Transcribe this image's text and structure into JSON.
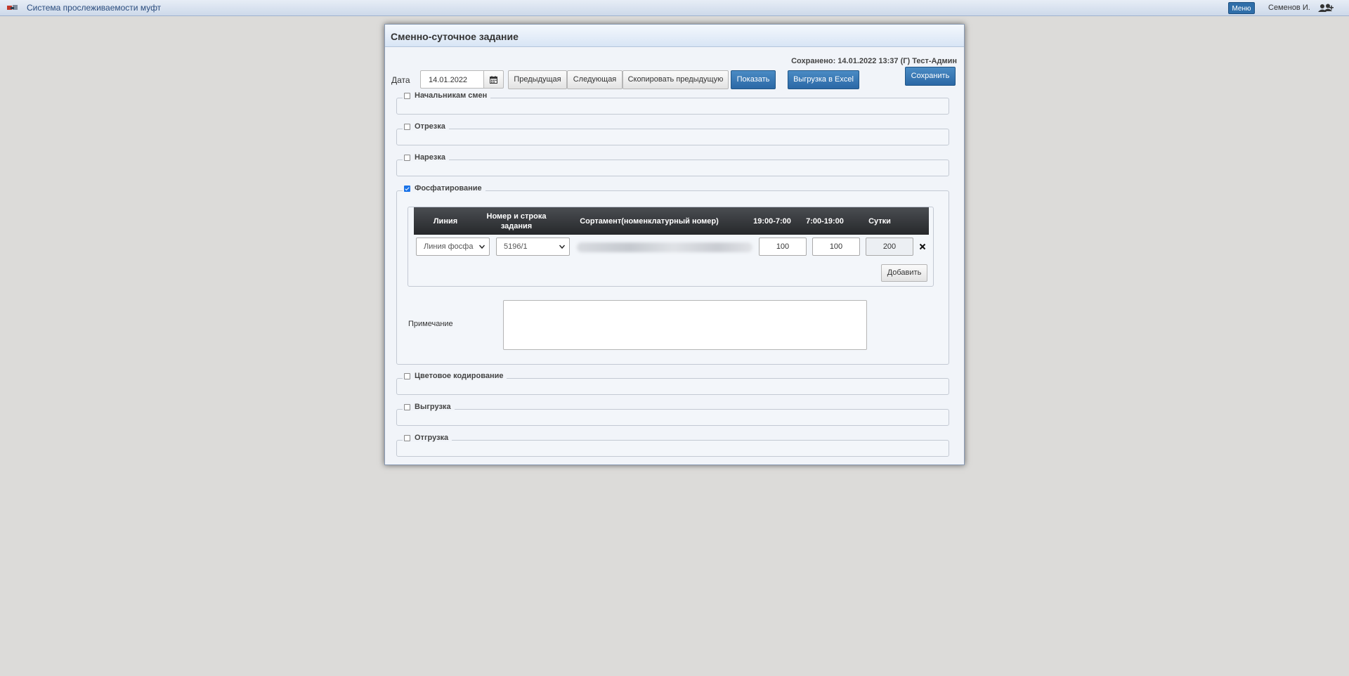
{
  "topbar": {
    "app_title": "Система прослеживаемости муфт",
    "menu_label": "Меню",
    "user_name": "Семенов И.",
    "user_icon": "users-icon",
    "logo_icon": "app-logo-icon"
  },
  "dialog": {
    "title": "Сменно-суточное задание",
    "saved_info": "Сохранено: 14.01.2022 13:37 (Г) Тест-Админ",
    "date_label": "Дата",
    "date_value": "14.01.2022",
    "calendar_icon": "calendar-icon",
    "buttons": {
      "prev": "Предыдущая",
      "next": "Следующая",
      "copy_prev": "Скопировать предыдущую",
      "show": "Показать",
      "excel": "Выгрузка в Excel",
      "save": "Сохранить"
    }
  },
  "sections": [
    {
      "label": "Начальникам смен",
      "checked": false
    },
    {
      "label": "Отрезка",
      "checked": false
    },
    {
      "label": "Нарезка",
      "checked": false
    },
    {
      "label": "Фосфатирование",
      "checked": true
    },
    {
      "label": "Цветовое кодирование",
      "checked": false
    },
    {
      "label": "Выгрузка",
      "checked": false
    },
    {
      "label": "Отгрузка",
      "checked": false
    }
  ],
  "phosphating": {
    "columns": [
      "Линия",
      "Номер и строка задания",
      "Сортамент(номенклатурный номер)",
      "19:00-7:00",
      "7:00-19:00",
      "Сутки"
    ],
    "rows": [
      {
        "line": "Линия фосфа",
        "task": "5196/1",
        "shift_night": "100",
        "shift_day": "100",
        "total": "200"
      }
    ],
    "remove_icon": "close-icon",
    "add_label": "Добавить",
    "note_label": "Примечание",
    "note_value": ""
  },
  "colors": {
    "accent": "#2f6ea9",
    "table_header": "#2f3134",
    "background": "#dcdbd9"
  }
}
